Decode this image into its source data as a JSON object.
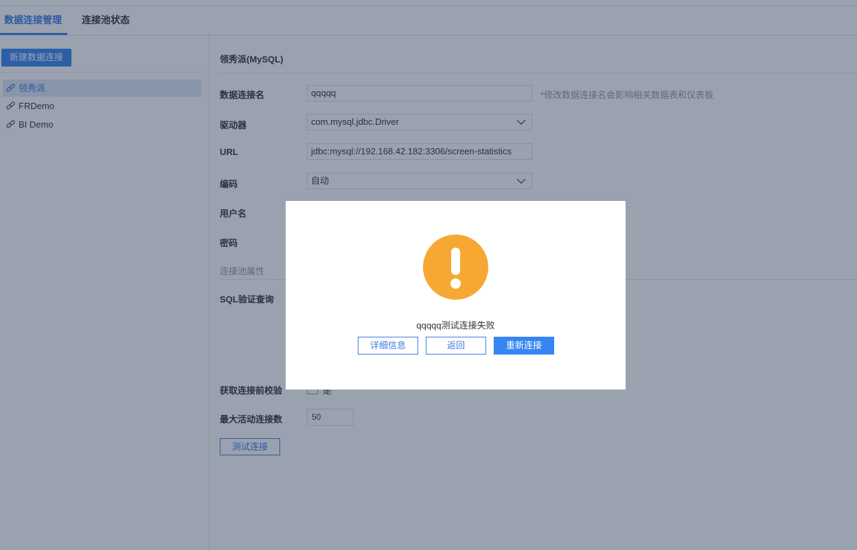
{
  "tabs": [
    {
      "label": "数据连接管理",
      "active": true
    },
    {
      "label": "连接池状态",
      "active": false
    }
  ],
  "sidebar": {
    "new_button": "新建数据连接",
    "connections": [
      {
        "label": "领秀派",
        "selected": true
      },
      {
        "label": "FRDemo",
        "selected": false
      },
      {
        "label": "BI Demo",
        "selected": false
      }
    ]
  },
  "form": {
    "title": "领秀派(MySQL)",
    "name_label": "数据连接名",
    "name_value": "qqqqq",
    "name_hint": "*修改数据连接名会影响相关数据表和仪表板",
    "driver_label": "驱动器",
    "driver_value": "com.mysql.jdbc.Driver",
    "url_label": "URL",
    "url_value": "jdbc:mysql://192.168.42.182:3306/screen-statistics",
    "encoding_label": "编码",
    "encoding_value": "自动",
    "user_label": "用户名",
    "password_label": "密码",
    "pool_section": "连接池属性",
    "sql_label": "SQL验证查询",
    "validate_label": "获取连接前校验",
    "validate_checkbox_label": "是",
    "max_active_label": "最大活动连接数",
    "max_active_value": "50",
    "test_button": "测试连接"
  },
  "dialog": {
    "message": "qqqqq测试连接失败",
    "details_button": "详细信息",
    "back_button": "返回",
    "reconnect_button": "重新连接"
  },
  "colors": {
    "accent": "#3685f2",
    "warning": "#f7a833"
  }
}
